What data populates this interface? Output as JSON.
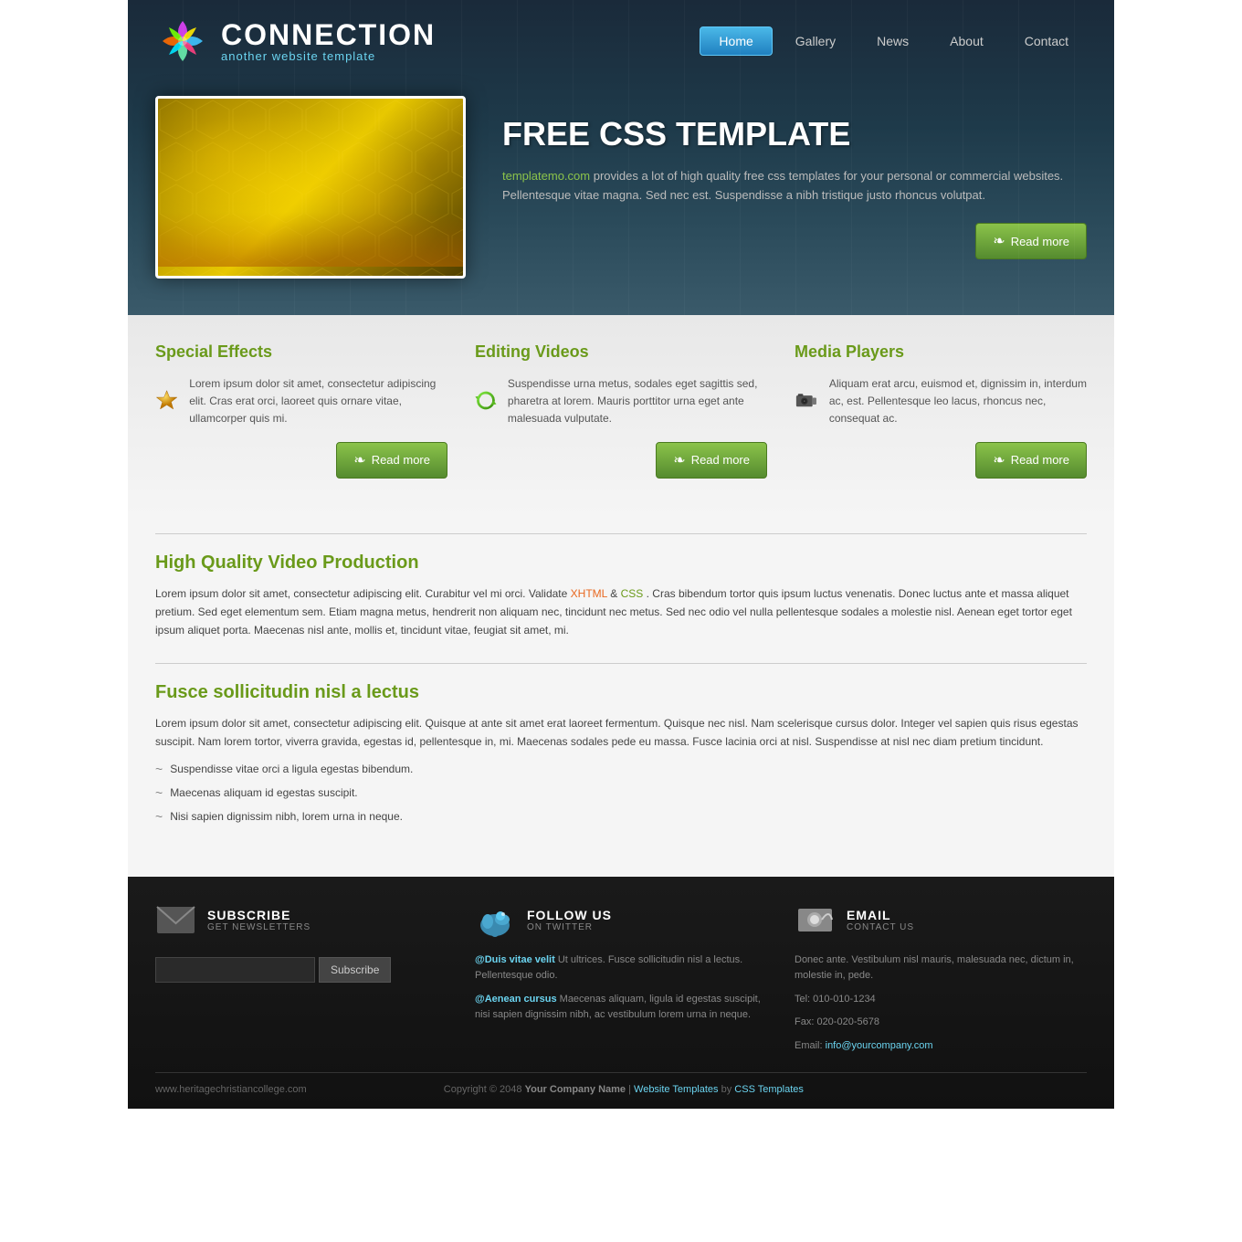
{
  "site": {
    "url": "www.heritagechristiancollege.com"
  },
  "logo": {
    "name": "CONNECTION",
    "tagline": "another website template"
  },
  "nav": {
    "items": [
      "Home",
      "Gallery",
      "News",
      "About",
      "Contact"
    ],
    "active": "Home"
  },
  "hero": {
    "title": "FREE CSS TEMPLATE",
    "link_text": "templatemo.com",
    "body": "provides a lot of high quality free css templates for your personal or commercial websites. Pellentesque vitae magna. Sed nec est. Suspendisse a nibh tristique justo rhoncus volutpat.",
    "read_more": "Read more"
  },
  "features": [
    {
      "title": "Special Effects",
      "body": "Lorem ipsum dolor sit amet, consectetur adipiscing elit. Cras erat orci, laoreet quis ornare vitae, ullamcorper quis mi.",
      "btn": "Read more"
    },
    {
      "title": "Editing Videos",
      "body": "Suspendisse urna metus, sodales eget sagittis sed, pharetra at lorem. Mauris porttitor urna eget ante malesuada vulputate.",
      "btn": "Read more"
    },
    {
      "title": "Media Players",
      "body": "Aliquam erat arcu, euismod et, dignissim in, interdum ac, est. Pellentesque leo lacus, rhoncus nec, consequat ac.",
      "btn": "Read more"
    }
  ],
  "sections": [
    {
      "title": "High Quality Video Production",
      "body": "Lorem ipsum dolor sit amet, consectetur adipiscing elit. Curabitur vel mi orci. Validate",
      "link1_text": "XHTML",
      "link2_text": "CSS",
      "body2": ". Cras bibendum tortor quis ipsum luctus venenatis. Donec luctus ante et massa aliquet pretium. Sed eget elementum sem. Etiam magna metus, hendrerit non aliquam nec, tincidunt nec metus. Sed nec odio vel nulla pellentesque sodales a molestie nisl. Aenean eget tortor eget ipsum aliquet porta. Maecenas nisl ante, mollis et, tincidunt vitae, feugiat sit amet, mi."
    },
    {
      "title": "Fusce sollicitudin nisl a lectus",
      "body": "Lorem ipsum dolor sit amet, consectetur adipiscing elit. Quisque at ante sit amet erat laoreet fermentum. Quisque nec nisl. Nam scelerisque cursus dolor. Integer vel sapien quis risus egestas suscipit. Nam lorem tortor, viverra gravida, egestas id, pellentesque in, mi. Maecenas sodales pede eu massa. Fusce lacinia orci at nisl. Suspendisse at nisl nec diam pretium tincidunt.",
      "bullets": [
        "Suspendisse vitae orci a ligula egestas bibendum.",
        "Maecenas aliquam id egestas suscipit.",
        "Nisi sapien dignissim nibh, lorem urna in neque."
      ]
    }
  ],
  "footer": {
    "subscribe": {
      "title": "SUBSCRIBE",
      "sub": "GET NEWSLETTERS",
      "placeholder": "",
      "btn": "Subscribe"
    },
    "follow": {
      "title": "FOLLOW US",
      "sub": "ON TWITTER",
      "post1_link": "@Duis vitae velit",
      "post1_body": " Ut ultrices. Fusce sollicitudin nisl a lectus. Pellentesque odio.",
      "post2_link": "@Aenean cursus",
      "post2_body": " Maecenas aliquam, ligula id egestas suscipit, nisi sapien dignissim nibh, ac vestibulum lorem urna in neque."
    },
    "email": {
      "title": "EMAIL",
      "sub": "CONTACT US",
      "body": "Donec ante. Vestibulum nisl mauris, malesuada nec, dictum in, molestie in, pede.",
      "tel": "Tel: 010-010-1234",
      "fax": "Fax: 020-020-5678",
      "email_label": "Email:",
      "email_addr": "info@yourcompany.com"
    },
    "copyright": "Copyright © 2048",
    "company": "Your Company Name",
    "sep": " | ",
    "website_templates": "Website Templates",
    "by": " by ",
    "css_templates": "CSS Templates"
  }
}
